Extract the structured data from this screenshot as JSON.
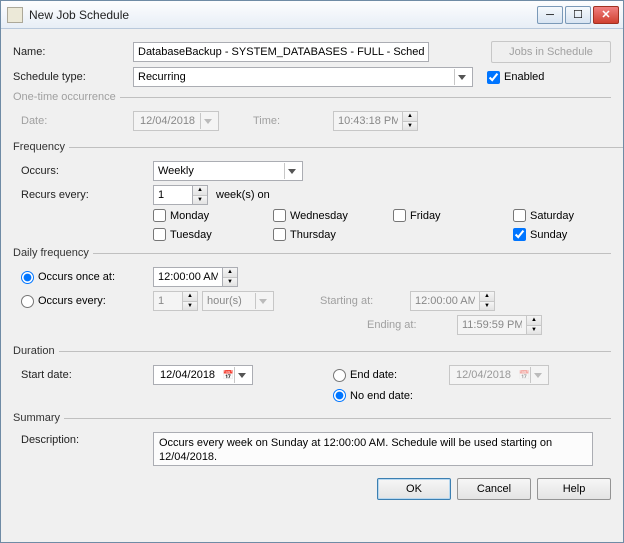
{
  "window": {
    "title": "New Job Schedule"
  },
  "name": {
    "label": "Name:",
    "value": "DatabaseBackup - SYSTEM_DATABASES - FULL - Schedule",
    "jobs_button": "Jobs in Schedule"
  },
  "schedule_type": {
    "label": "Schedule type:",
    "value": "Recurring",
    "enabled_label": "Enabled",
    "enabled": true
  },
  "one_time": {
    "legend": "One-time occurrence",
    "date_label": "Date:",
    "date_value": "12/04/2018",
    "time_label": "Time:",
    "time_value": "10:43:18 PM"
  },
  "frequency": {
    "legend": "Frequency",
    "occurs_label": "Occurs:",
    "occurs_value": "Weekly",
    "recurs_label": "Recurs every:",
    "recurs_value": "1",
    "recurs_unit": "week(s) on",
    "days": {
      "monday": "Monday",
      "tuesday": "Tuesday",
      "wednesday": "Wednesday",
      "thursday": "Thursday",
      "friday": "Friday",
      "saturday": "Saturday",
      "sunday": "Sunday"
    },
    "checked": {
      "monday": false,
      "tuesday": false,
      "wednesday": false,
      "thursday": false,
      "friday": false,
      "saturday": false,
      "sunday": true
    }
  },
  "daily": {
    "legend": "Daily frequency",
    "once_label": "Occurs once at:",
    "once_value": "12:00:00 AM",
    "every_label": "Occurs every:",
    "every_value": "1",
    "every_unit": "hour(s)",
    "starting_label": "Starting at:",
    "starting_value": "12:00:00 AM",
    "ending_label": "Ending at:",
    "ending_value": "11:59:59 PM"
  },
  "duration": {
    "legend": "Duration",
    "start_label": "Start date:",
    "start_value": "12/04/2018",
    "end_label": "End date:",
    "end_value": "12/04/2018",
    "noend_label": "No end date:"
  },
  "summary": {
    "legend": "Summary",
    "desc_label": "Description:",
    "desc_value": "Occurs every week on Sunday at 12:00:00 AM. Schedule will be used starting on 12/04/2018."
  },
  "buttons": {
    "ok": "OK",
    "cancel": "Cancel",
    "help": "Help"
  }
}
